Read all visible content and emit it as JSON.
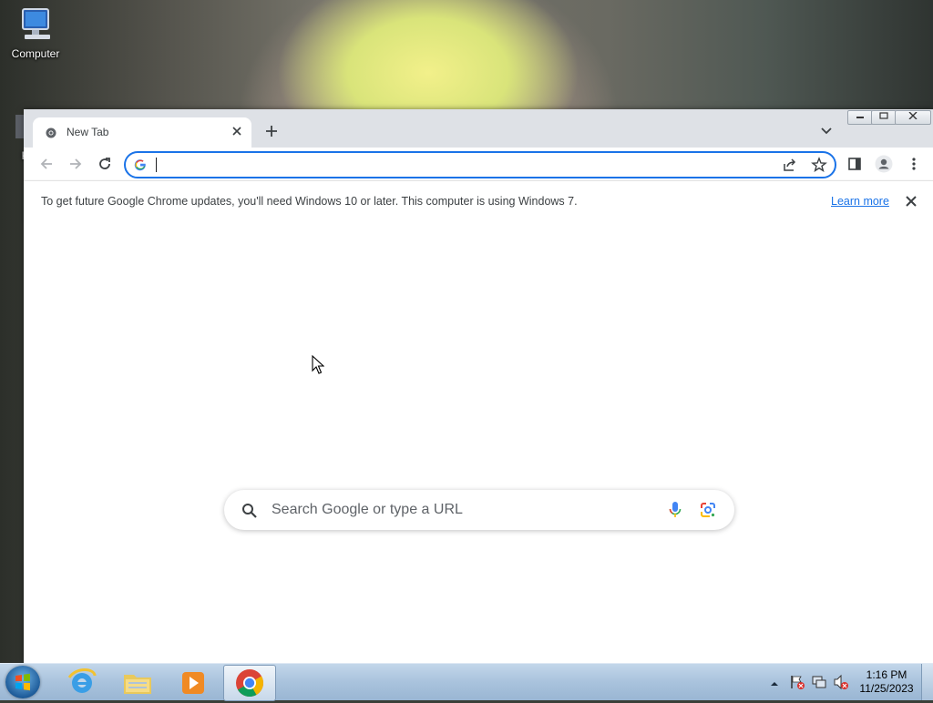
{
  "desktop": {
    "icons": [
      {
        "label": "Computer"
      },
      {
        "label": "Ka"
      }
    ]
  },
  "browser": {
    "tab": {
      "title": "New Tab",
      "close_icon": "close-icon"
    },
    "new_tab_icon": "plus-icon",
    "tab_search_icon": "chevron-down-icon",
    "window_buttons": [
      "minimize",
      "restore",
      "close"
    ],
    "toolbar": {
      "back_icon": "back-arrow-icon",
      "forward_icon": "forward-arrow-icon",
      "reload_icon": "reload-icon",
      "omnibox_value": "",
      "share_icon": "share-icon",
      "bookmark_icon": "star-icon",
      "side_panel_icon": "side-panel-icon",
      "profile_icon": "profile-icon",
      "menu_icon": "kebab-menu-icon"
    },
    "infobar": {
      "message": "To get future Google Chrome updates, you'll need Windows 10 or later. This computer is using Windows 7.",
      "link": "Learn more"
    },
    "ntp": {
      "search_placeholder": "Search Google or type a URL"
    },
    "colors": {
      "accent": "#1a73e8",
      "titlebar": "#dee1e6"
    }
  },
  "taskbar": {
    "apps": [
      "Internet Explorer",
      "Windows Explorer",
      "Windows Media Player",
      "Google Chrome"
    ],
    "active_app": "Google Chrome",
    "clock": {
      "time": "1:16 PM",
      "date": "11/25/2023"
    }
  }
}
